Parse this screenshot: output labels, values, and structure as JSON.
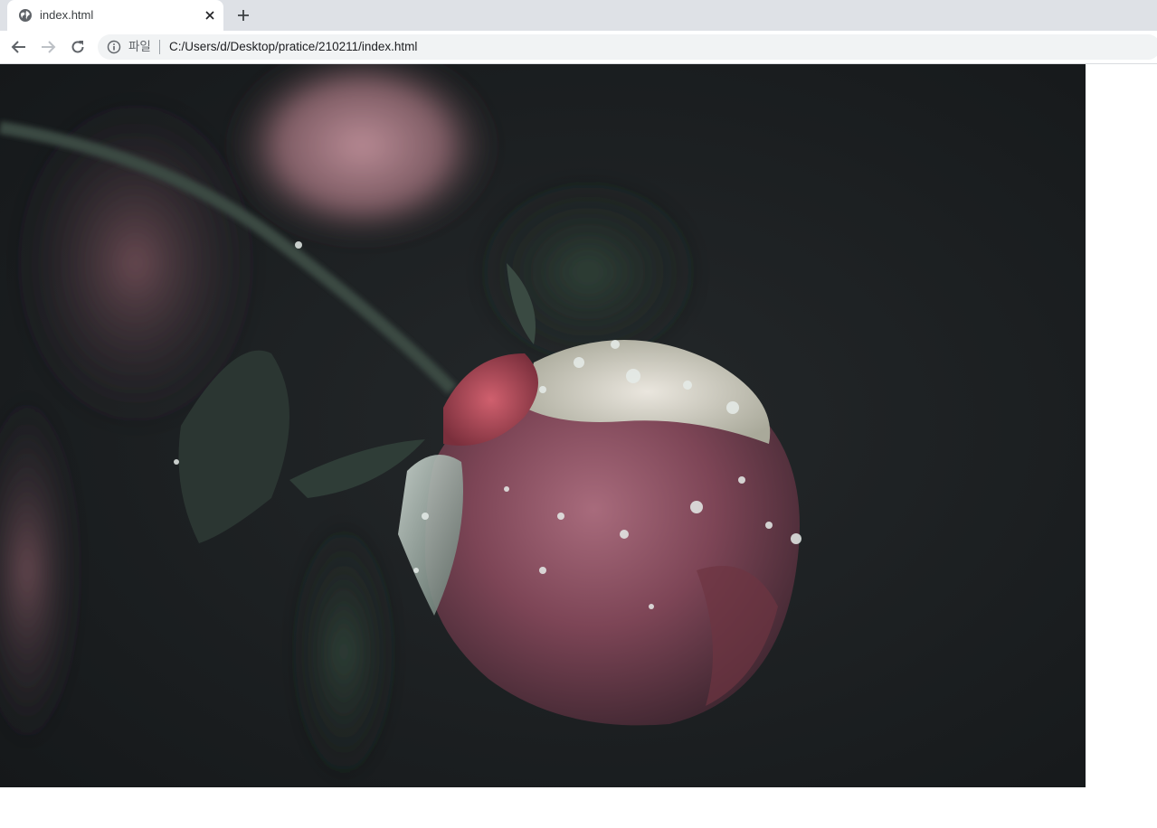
{
  "browser": {
    "tab": {
      "title": "index.html",
      "favicon": "globe-icon",
      "close_icon": "close-icon"
    },
    "new_tab_icon": "plus-icon",
    "nav": {
      "back_icon": "arrow-left-icon",
      "forward_icon": "arrow-right-icon",
      "reload_icon": "reload-icon"
    },
    "address_bar": {
      "info_icon": "info-icon",
      "scheme_label": "파일",
      "url": "C:/Users/d/Desktop/pratice/210211/index.html"
    }
  },
  "page": {
    "image": {
      "subject": "photo-of-rose-bud-with-water-droplets"
    }
  },
  "colors": {
    "tabbar_bg": "#dee1e6",
    "omnibox_bg": "#f1f3f4",
    "photo_bg": "#1f2224",
    "rose_main": "#8a4a58",
    "rose_highlight": "#c96a7a",
    "droplet": "#e6ece9"
  }
}
